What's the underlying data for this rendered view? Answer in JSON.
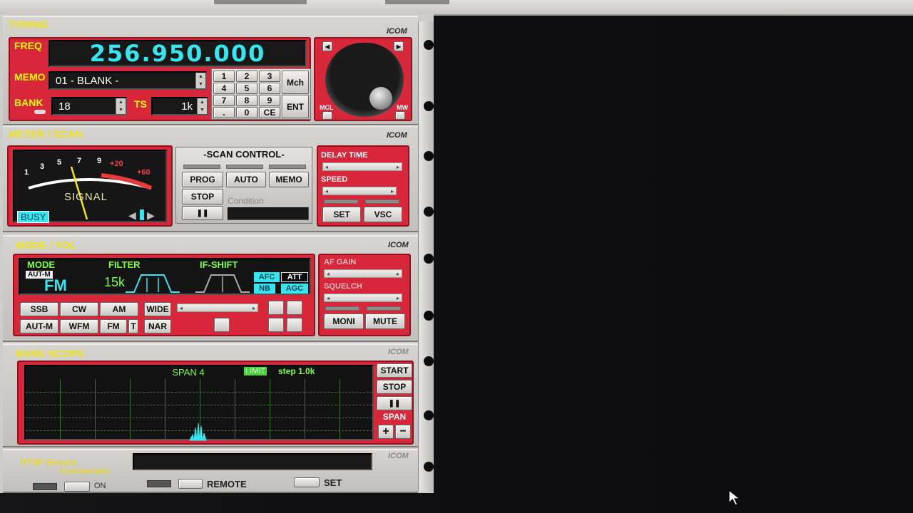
{
  "tuning": {
    "title": "TUNING",
    "brand": "ICOM",
    "freq_label": "FREQ",
    "freq_value": "256.950.000",
    "memo_label": "MEMO",
    "memo_value": "01 - BLANK -",
    "bank_label": "BANK",
    "bank_value": "18",
    "ts_label": "TS",
    "ts_value": "1k",
    "keypad": [
      "1",
      "2",
      "3",
      "4",
      "5",
      "6",
      "7",
      "8",
      "9",
      ".",
      "0",
      "CE"
    ],
    "mch_label": "Mch",
    "ent_label": "ENT",
    "mcl_label": "MCL",
    "mw_label": "MW"
  },
  "meter": {
    "title": "METER / SCAN",
    "brand": "ICOM",
    "scale": [
      "1",
      "3",
      "5",
      "7",
      "9",
      "+20",
      "+60"
    ],
    "signal_label": "SIGNAL",
    "busy_label": "BUSY",
    "scan_control_title": "-SCAN CONTROL-",
    "prog_label": "PROG",
    "auto_label": "AUTO",
    "memo_label": "MEMO",
    "stop_label": "STOP",
    "condition_label": "Condition",
    "pause_label": "❚❚",
    "delay_time_label": "DELAY TIME",
    "speed_label": "SPEED",
    "set_label": "SET",
    "vsc_label": "VSC"
  },
  "mode": {
    "title": "MODE / VOL",
    "brand": "ICOM",
    "mode_label": "MODE",
    "autm_badge": "AUT-M",
    "mode_value": "FM",
    "filter_label": "FILTER",
    "filter_value": "15k",
    "ifshift_label": "IF-SHIFT",
    "afc_label": "AFC",
    "att_label": "ATT",
    "nb_label": "NB",
    "agc_label": "AGC",
    "ssb_label": "SSB",
    "cw_label": "CW",
    "am_label": "AM",
    "wide_label": "WIDE",
    "autm_label": "AUT-M",
    "wfm_label": "WFM",
    "fm_label": "FM",
    "t_label": "T",
    "nar_label": "NAR",
    "af_gain_label": "AF GAIN",
    "squelch_label": "SQUELCH",
    "moni_label": "MONI",
    "mute_label": "MUTE"
  },
  "scope": {
    "title": "BAND SCOPE",
    "brand": "ICOM",
    "span_text": "SPAN 4",
    "limit_text": "LIMIT",
    "step_text": "step 1.0k",
    "start_label": "START",
    "stop_label": "STOP",
    "pause_label": "❚❚",
    "span_label": "SPAN",
    "plus_label": "+",
    "minus_label": "−"
  },
  "dtmf": {
    "title_line1": "DTMF Remote",
    "title_line2": "Commander",
    "brand": "ICOM",
    "on_label": "ON",
    "remote_label": "REMOTE",
    "set_label": "SET"
  },
  "colors": {
    "accent_red": "#d8263a",
    "lcd_cyan": "#35e6f0",
    "label_yellow": "#ffff00",
    "label_green": "#7cff3c"
  }
}
